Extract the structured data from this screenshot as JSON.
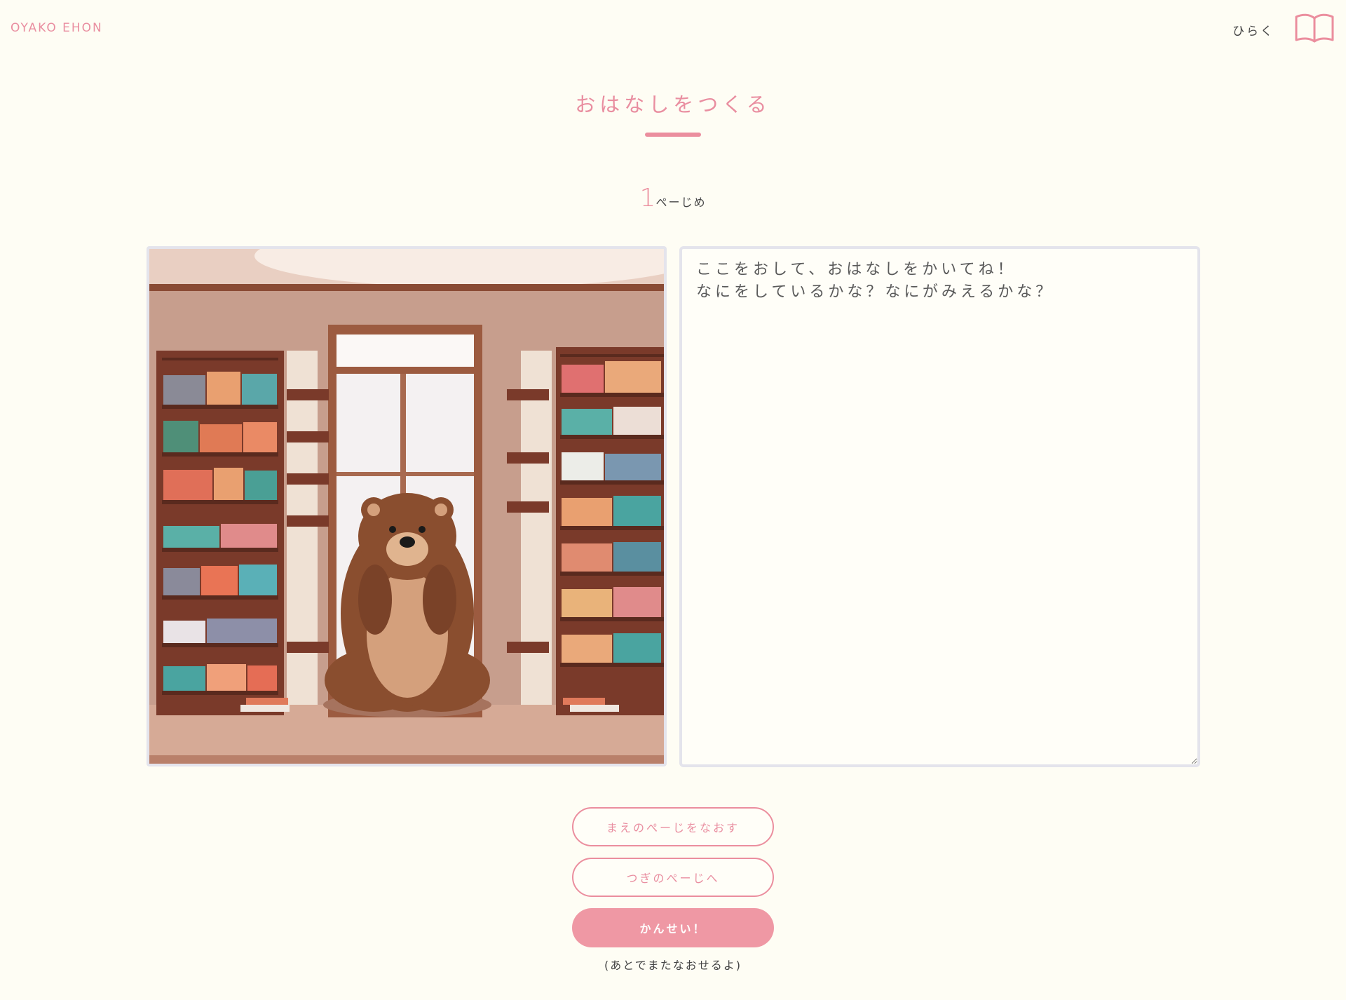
{
  "header": {
    "brand": "OYAKO EHON",
    "open_label": "ひらく",
    "book_icon": "open-book-icon"
  },
  "main": {
    "title": "おはなしをつくる",
    "page_number": "1",
    "page_suffix": "ぺーじめ",
    "story_placeholder": "ここをおして、おはなしをかいてね！\nなにをしているかな？なにがみえるかな？",
    "story_value": ""
  },
  "actions": {
    "prev_label": "まえのぺーじをなおす",
    "next_label": "つぎのぺーじへ",
    "finish_label": "かんせい！",
    "note": "(あとでまたなおせるよ)"
  },
  "colors": {
    "accent": "#eb8e9e",
    "background": "#fefdf4",
    "finish_button": "#ef98a4"
  }
}
